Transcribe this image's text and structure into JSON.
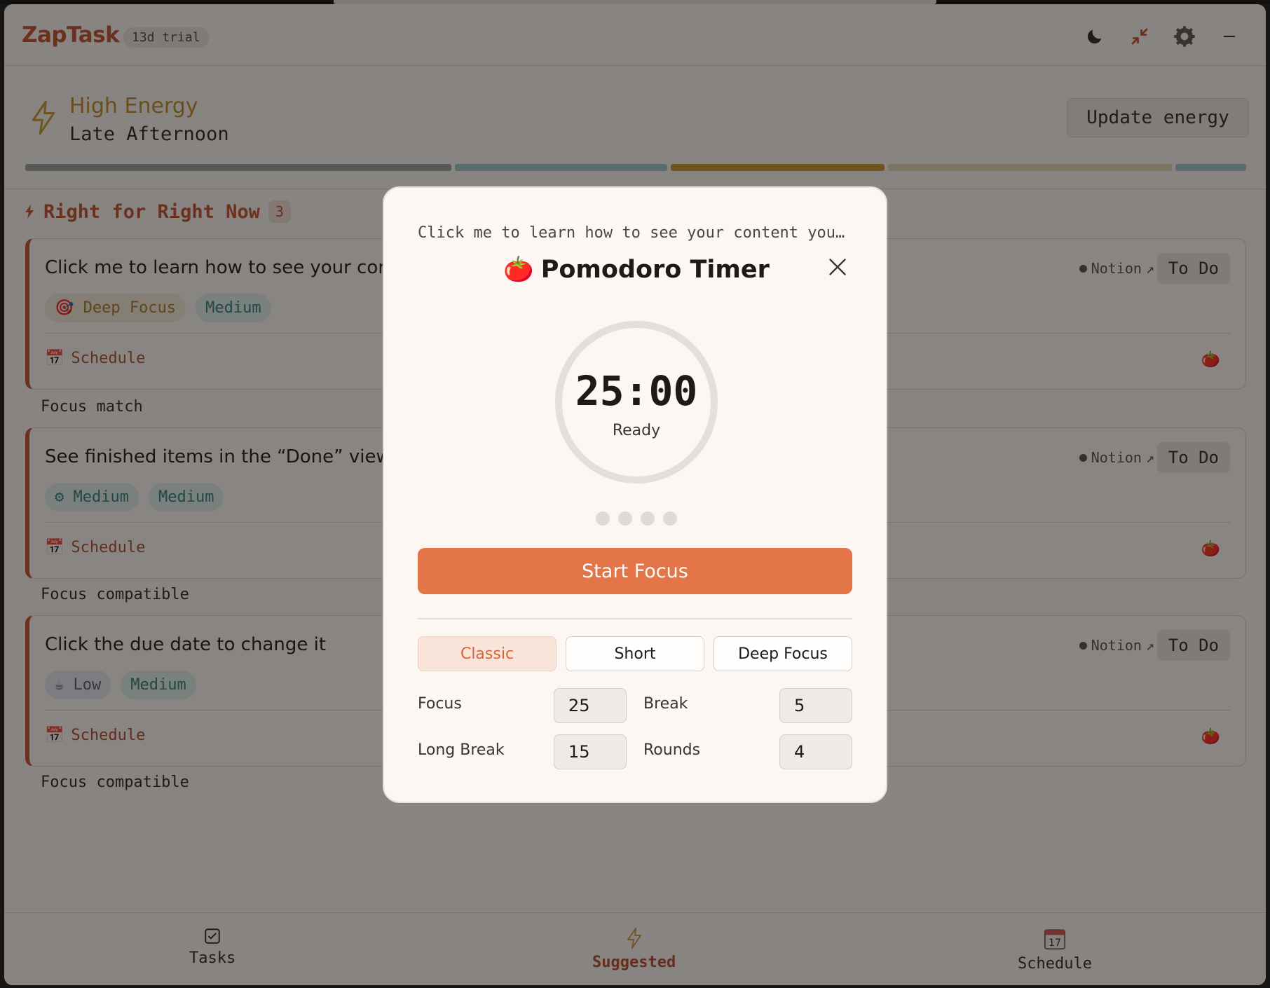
{
  "app": {
    "name": "ZapTask",
    "trial": "13d trial"
  },
  "header": {
    "icons": [
      "moon-icon",
      "collapse-icon",
      "settings-gear-icon",
      "minimize-icon"
    ]
  },
  "energy": {
    "level": "High Energy",
    "time_of_day": "Late Afternoon",
    "update_label": "Update energy",
    "segment_colors": [
      "#9aa0a3",
      "#9fc6c8",
      "#c9962a",
      "#e8d7b4",
      "#9fc6c8"
    ]
  },
  "suggestions": {
    "title": "Right for Right Now",
    "count": "3",
    "cards": [
      {
        "title": "Click me to learn how to see your cont",
        "tags": [
          "Deep Focus",
          "Medium"
        ],
        "tag_icons": [
          "target-icon"
        ],
        "source": "Notion",
        "status": "To Do",
        "schedule": "Schedule",
        "match": "Focus match"
      },
      {
        "title": "See finished items in the “Done” view",
        "tags": [
          "Medium",
          "Medium"
        ],
        "tag_icons": [
          "gear-icon"
        ],
        "source": "Notion",
        "status": "To Do",
        "schedule": "Schedule",
        "match": "Focus compatible"
      },
      {
        "title": "Click the due date to change it",
        "tags": [
          "Low",
          "Medium"
        ],
        "tag_icons": [
          "coffee-icon"
        ],
        "source": "Notion",
        "status": "To Do",
        "schedule": "Schedule",
        "match": "Focus compatible"
      }
    ]
  },
  "nav": {
    "tasks": "Tasks",
    "suggested": "Suggested",
    "schedule": "Schedule",
    "schedule_day": "17"
  },
  "modal": {
    "subtitle": "Click me to learn how to see your content you…",
    "title": "Pomodoro Timer",
    "emoji": "🍅",
    "time": "25:00",
    "state": "Ready",
    "rounds_dots": 4,
    "start_label": "Start Focus",
    "presets": [
      "Classic",
      "Short",
      "Deep Focus"
    ],
    "active_preset": "Classic",
    "settings": {
      "focus_label": "Focus",
      "focus_value": "25",
      "break_label": "Break",
      "break_value": "5",
      "long_break_label": "Long Break",
      "long_break_value": "15",
      "rounds_label": "Rounds",
      "rounds_value": "4"
    }
  }
}
